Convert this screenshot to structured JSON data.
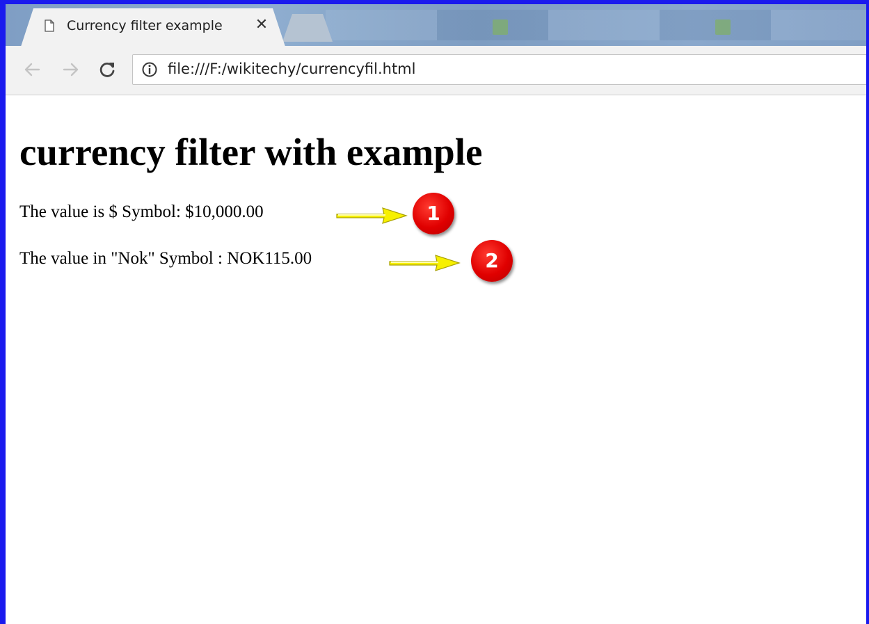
{
  "tab": {
    "title": "Currency filter example",
    "close": "✕"
  },
  "toolbar": {
    "back_icon": "arrow-left-icon",
    "forward_icon": "arrow-right-icon",
    "reload_icon": "reload-icon",
    "url": "file:///F:/wikitechy/currencyfil.html"
  },
  "page": {
    "title": "currency filter with example",
    "lines": [
      {
        "text": "The value is $ Symbol: $10,000.00",
        "badge": "1"
      },
      {
        "text": "The value in \"Nok\" Symbol : NOK115.00",
        "badge": "2"
      }
    ]
  },
  "colors": {
    "frame": "#1a1aee",
    "badge": "#e00000",
    "arrow": "#f5f000"
  }
}
